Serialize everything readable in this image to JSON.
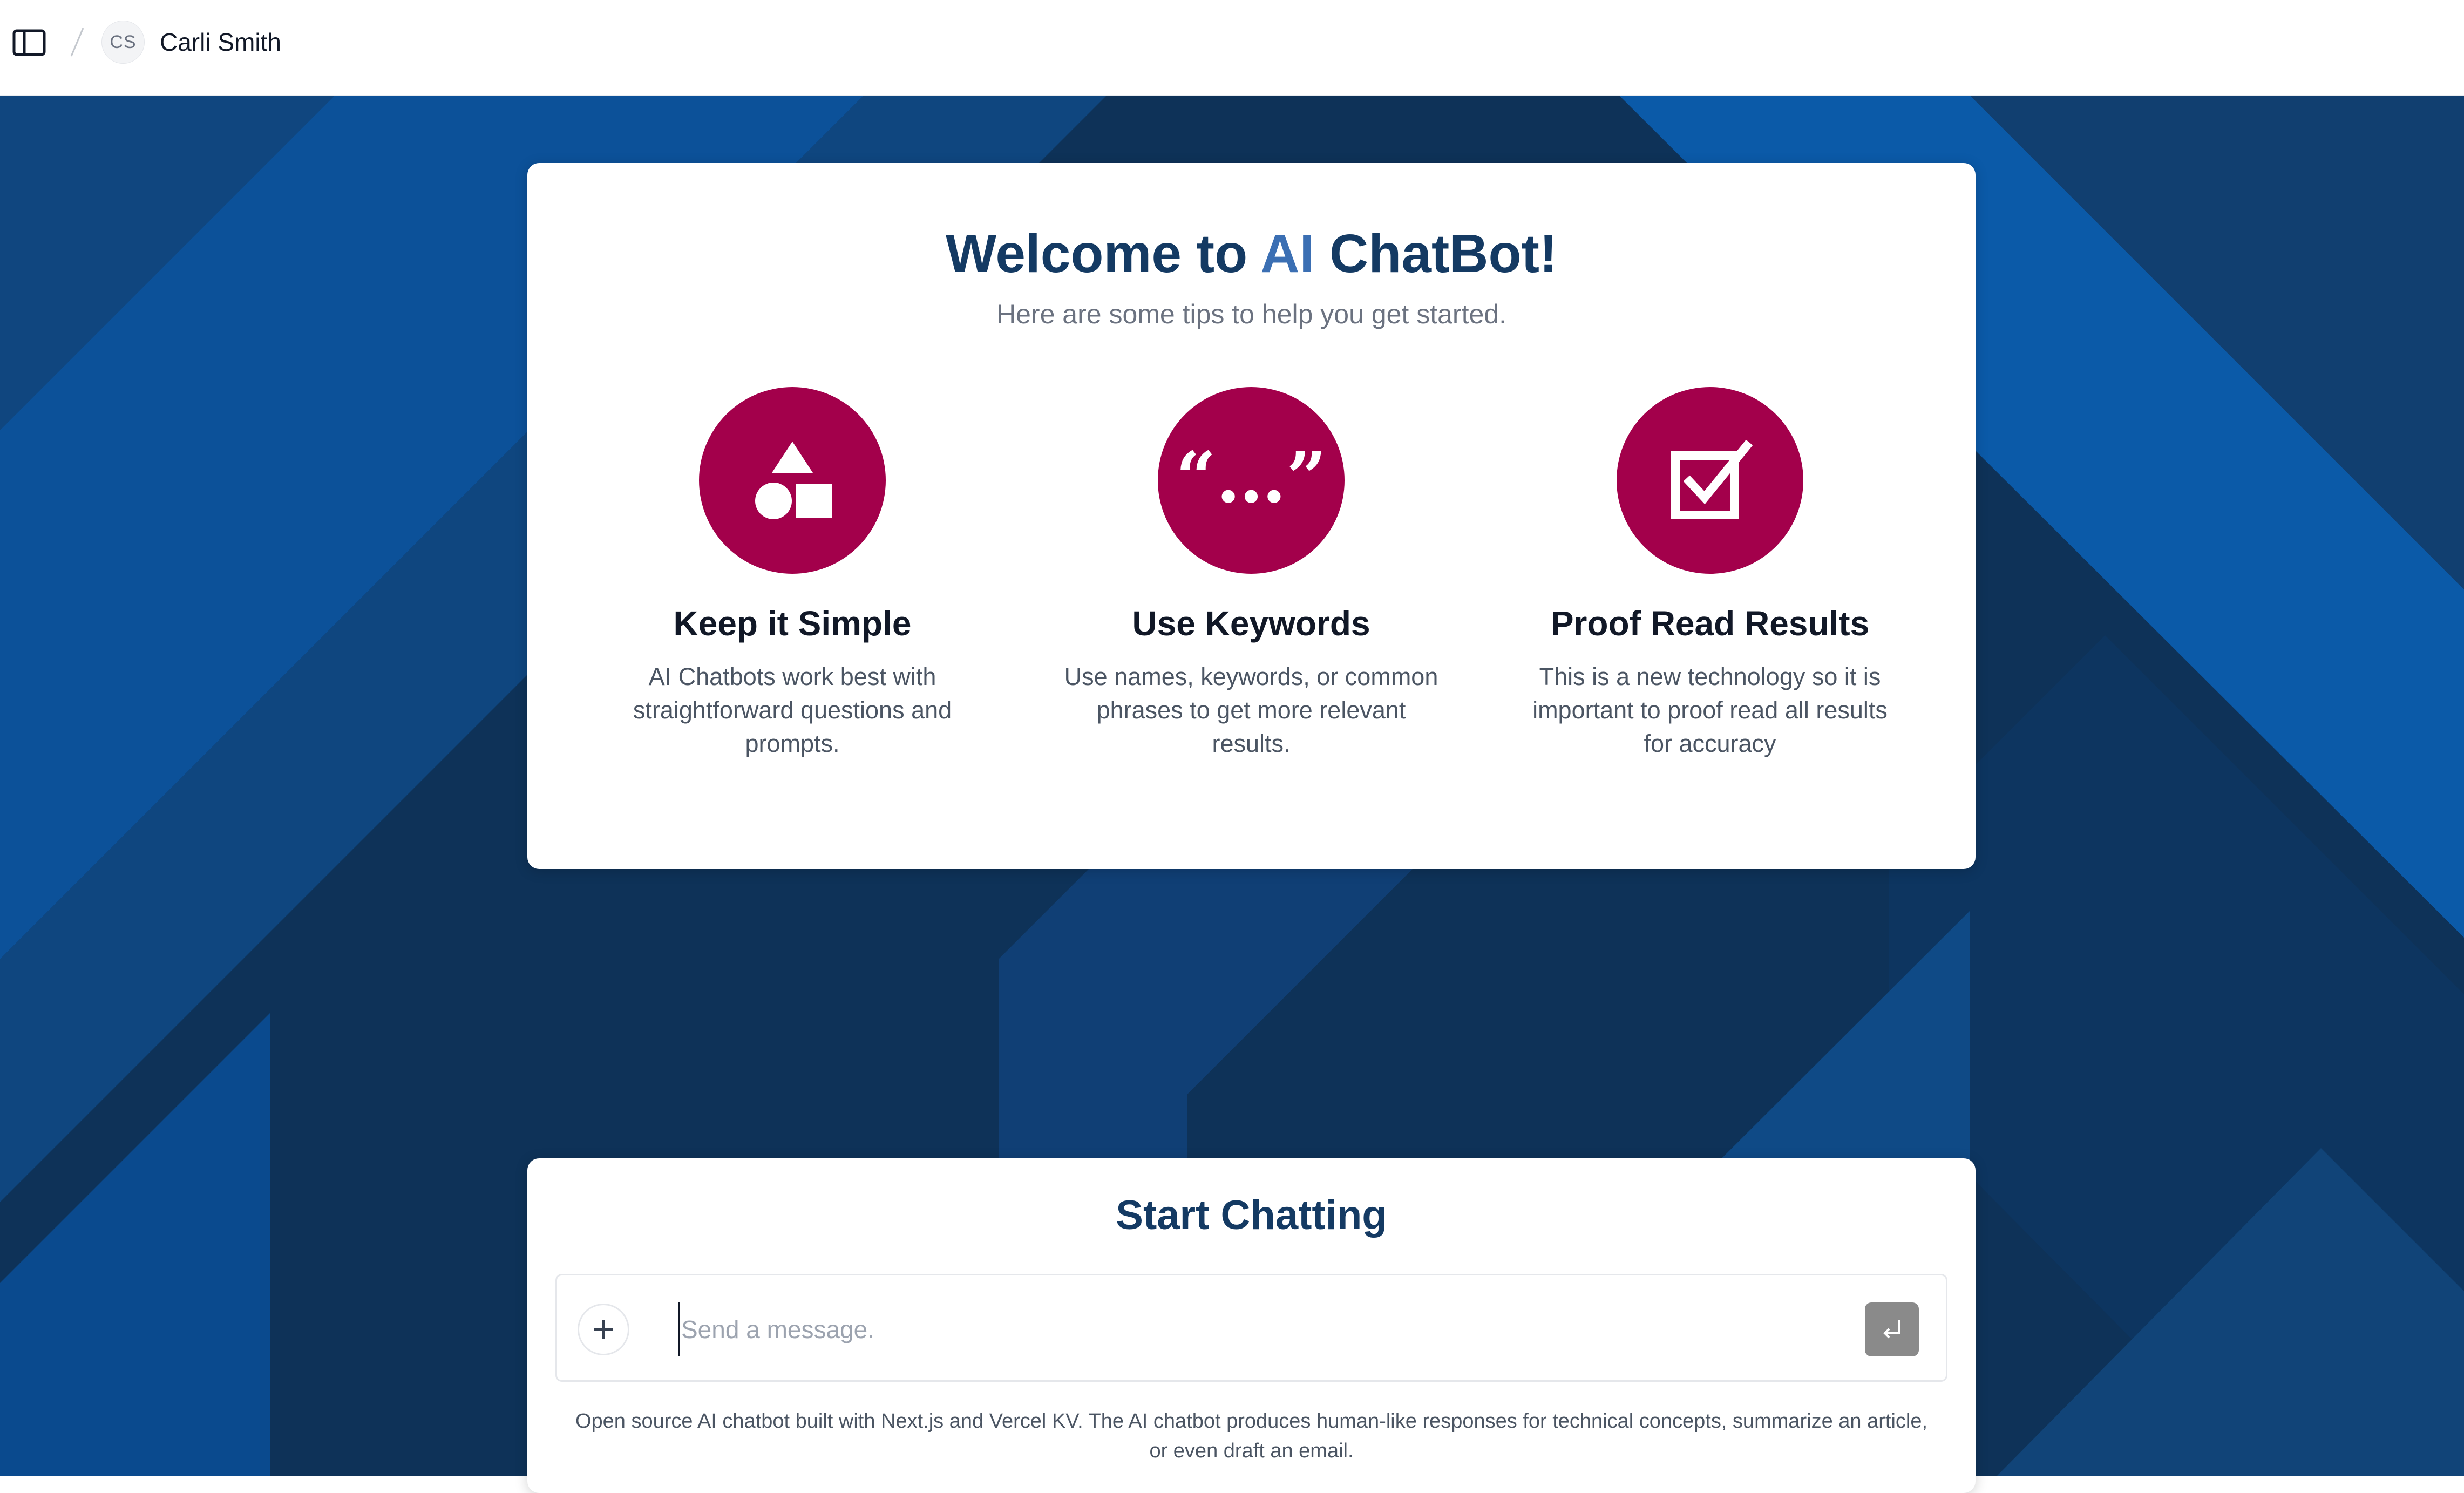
{
  "header": {
    "sidebar_toggle_icon": "sidebar-panel-icon",
    "separator": "/",
    "avatar_initials": "CS",
    "user_name": "Carli Smith"
  },
  "colors": {
    "navy_dark": "#0e3258",
    "navy_mid": "#10467f",
    "blue_bright": "#0a5aa8",
    "tip_icon_bg": "#a3004b",
    "title_navy": "#143a63",
    "title_accent": "#3b6fb3"
  },
  "welcome": {
    "title_prefix": "Welcome to ",
    "title_ai": "AI",
    "title_suffix": " ChatBot!",
    "subtitle": "Here are some tips to help you get started.",
    "tips": [
      {
        "icon": "shapes-icon",
        "title": "Keep it Simple",
        "description": "AI Chatbots work best with straightforward questions and prompts."
      },
      {
        "icon": "quote-marks-icon",
        "title": "Use Keywords",
        "description": "Use names, keywords, or common phrases to get more relevant results."
      },
      {
        "icon": "checkbox-check-icon",
        "title": "Proof Read Results",
        "description": "This is a new technology so it is important to proof read all results for accuracy"
      }
    ]
  },
  "chat": {
    "title": "Start Chatting",
    "input_placeholder": "Send a message.",
    "input_value": "",
    "plus_icon": "plus-icon",
    "send_icon": "enter-return-icon",
    "disclaimer": "Open source AI chatbot built with Next.js and Vercel KV. The AI chatbot produces human-like responses for technical concepts, summarize an article, or even draft an email."
  }
}
